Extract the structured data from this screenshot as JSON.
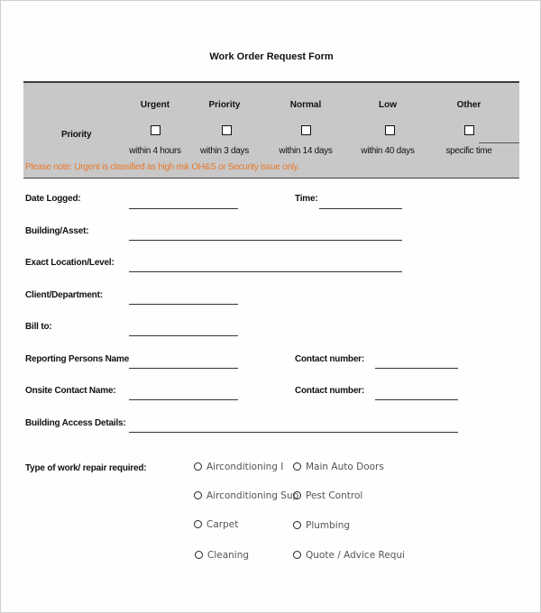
{
  "form": {
    "title": "Work Order Request Form"
  },
  "priority": {
    "label": "Priority",
    "options": [
      {
        "name": "Urgent",
        "timeframe": "within 4 hours",
        "checked": false
      },
      {
        "name": "Priority",
        "timeframe": "within 3 days",
        "checked": false
      },
      {
        "name": "Normal",
        "timeframe": "within 14 days",
        "checked": false
      },
      {
        "name": "Low",
        "timeframe": "within 40 days",
        "checked": false
      },
      {
        "name": "Other",
        "timeframe": "specific time",
        "checked": false
      }
    ],
    "note": "Please note: Urgent is classified as high risk OH&S or Security issue only.",
    "note_color": "#e8782a"
  },
  "fields": {
    "date_logged": {
      "label": "Date Logged:",
      "value": ""
    },
    "time": {
      "label": "Time:",
      "value": ""
    },
    "building_asset": {
      "label": "Building/Asset:",
      "value": ""
    },
    "exact_location": {
      "label": "Exact Location/Level:",
      "value": ""
    },
    "client_department": {
      "label": "Client/Department:",
      "value": ""
    },
    "bill_to": {
      "label": "Bill to:",
      "value": ""
    },
    "reporting_person": {
      "label": "Reporting Persons Name",
      "value": ""
    },
    "reporting_contact": {
      "label": "Contact number:",
      "value": ""
    },
    "onsite_contact": {
      "label": "Onsite Contact Name:",
      "value": ""
    },
    "onsite_contact_number": {
      "label": "Contact number:",
      "value": ""
    },
    "building_access": {
      "label": "Building Access Details:",
      "value": ""
    }
  },
  "work_type": {
    "label": "Type of work/ repair required:",
    "options": [
      {
        "label": "Airconditioning I",
        "selected": false
      },
      {
        "label": "Main Auto Doors",
        "selected": false
      },
      {
        "label": "Airconditioning Sup",
        "selected": false
      },
      {
        "label": "Pest Control",
        "selected": false
      },
      {
        "label": "Carpet",
        "selected": false
      },
      {
        "label": "Plumbing",
        "selected": false
      },
      {
        "label": "Cleaning",
        "selected": false
      },
      {
        "label": "Quote / Advice Requi",
        "selected": false
      }
    ]
  }
}
